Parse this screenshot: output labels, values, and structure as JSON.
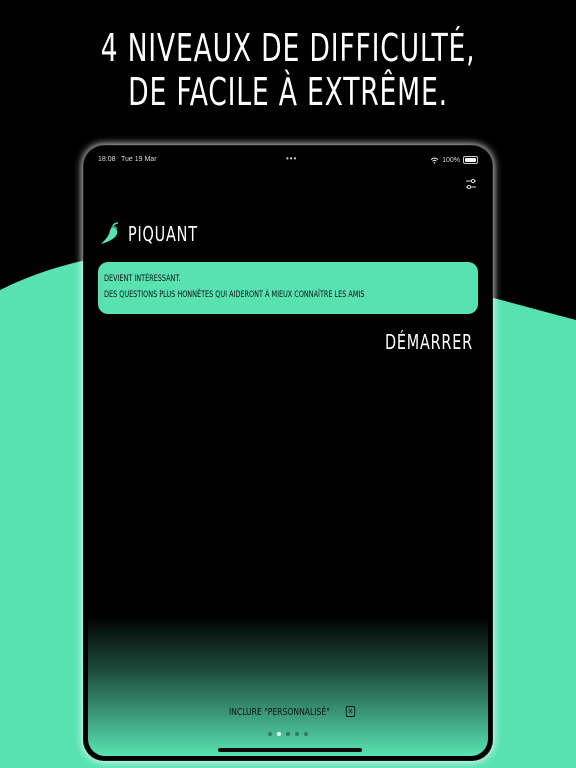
{
  "headline": {
    "line1": "4 NIVEAUX DE DIFFICULTÉ,",
    "line2": "DE FACILE À EXTRÊME."
  },
  "colors": {
    "accent": "#58e2b2",
    "background": "#000000",
    "text": "#ffffff"
  },
  "status_bar": {
    "time": "18:08",
    "date": "Tue 19 Mar",
    "battery": "100%"
  },
  "toolbar": {
    "settings_icon": "sliders-icon"
  },
  "level": {
    "icon": "chili-pepper-icon",
    "title": "PIQUANT",
    "description_line1": "DEVIENT INTÉRESSANT.",
    "description_line2": "DES QUESTIONS PLUS HONNÊTES QUI AIDERONT À MIEUX CONNAÎTRE LES AMIS"
  },
  "start_button": "DÉMARRER",
  "include_custom": {
    "label": "INCLURE \"PERSONNALISÉ\"",
    "checkbox_icon": "x-checkbox-icon"
  },
  "pager": {
    "count": 5,
    "active_index": 1
  }
}
